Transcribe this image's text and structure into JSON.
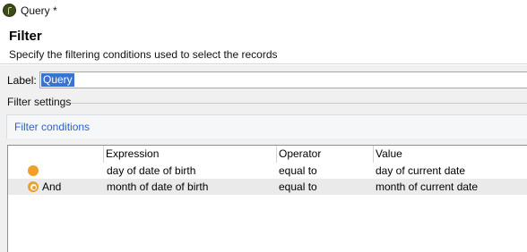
{
  "window": {
    "title": "Query *",
    "icon": "app-logo-icon"
  },
  "header": {
    "title": "Filter",
    "subtitle": "Specify the filtering conditions used to select the records"
  },
  "label_field": {
    "label": "Label:",
    "value": "Query"
  },
  "filter_settings": {
    "legend": "Filter settings",
    "conditions_link": "Filter conditions"
  },
  "grid": {
    "columns": [
      "Expression",
      "Operator",
      "Value"
    ],
    "rows": [
      {
        "icon": "condition-dot-icon",
        "logic": "",
        "expression": "day of date of birth",
        "operator": "equal to",
        "value": "day of current date"
      },
      {
        "icon": "and-condition-icon",
        "logic": "And",
        "expression": "month of date of birth",
        "operator": "equal to",
        "value": "month of current date"
      }
    ]
  },
  "colors": {
    "accent": "#3a73cf",
    "link": "#2a62c9",
    "condition": "#eea02a"
  }
}
